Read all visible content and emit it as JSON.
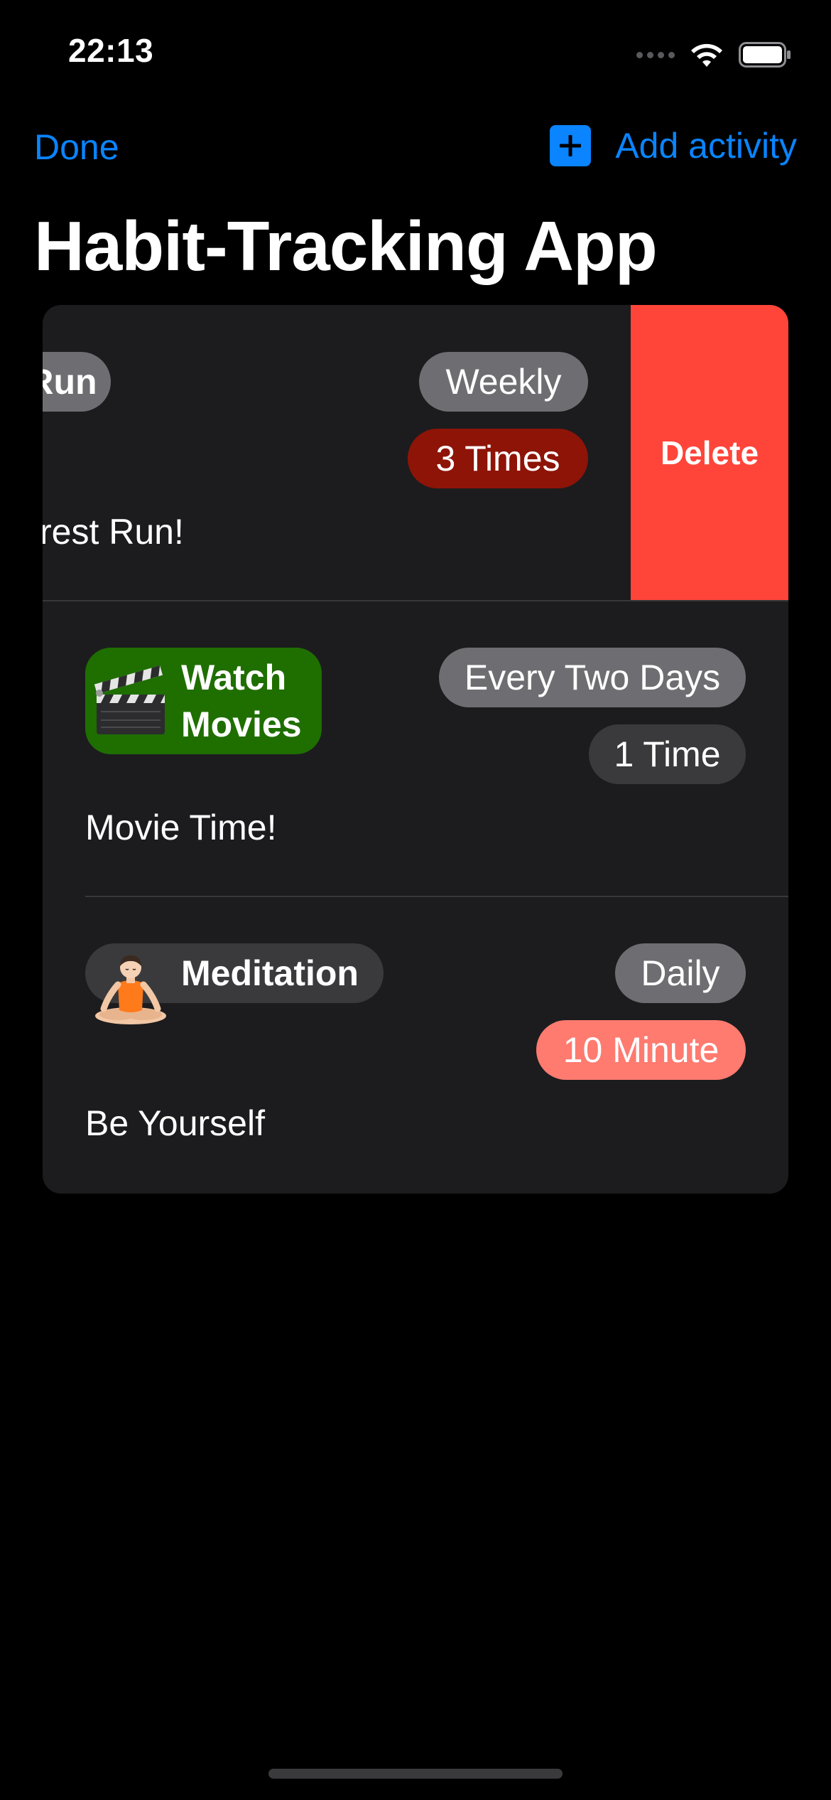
{
  "status_bar": {
    "time": "22:13"
  },
  "nav": {
    "done_label": "Done",
    "add_label": "Add activity",
    "add_icon": "plus-icon"
  },
  "title": "Habit-Tracking App",
  "colors": {
    "accent": "#0a84ff",
    "delete": "#ff453a",
    "card": "#1c1c1e"
  },
  "activities": [
    {
      "name": "Run",
      "frequency": "Weekly",
      "count": "3 Times",
      "note": "rest Run!",
      "swiped": true,
      "delete_label": "Delete"
    },
    {
      "icon": "clapper-board-icon",
      "name": "Watch Movies",
      "name_line1": "Watch",
      "name_line2": "Movies",
      "frequency": "Every Two Days",
      "count": "1 Time",
      "note": "Movie Time!"
    },
    {
      "icon": "meditation-person-icon",
      "name": "Meditation",
      "frequency": "Daily",
      "count": "10 Minute",
      "note": "Be Yourself"
    }
  ]
}
